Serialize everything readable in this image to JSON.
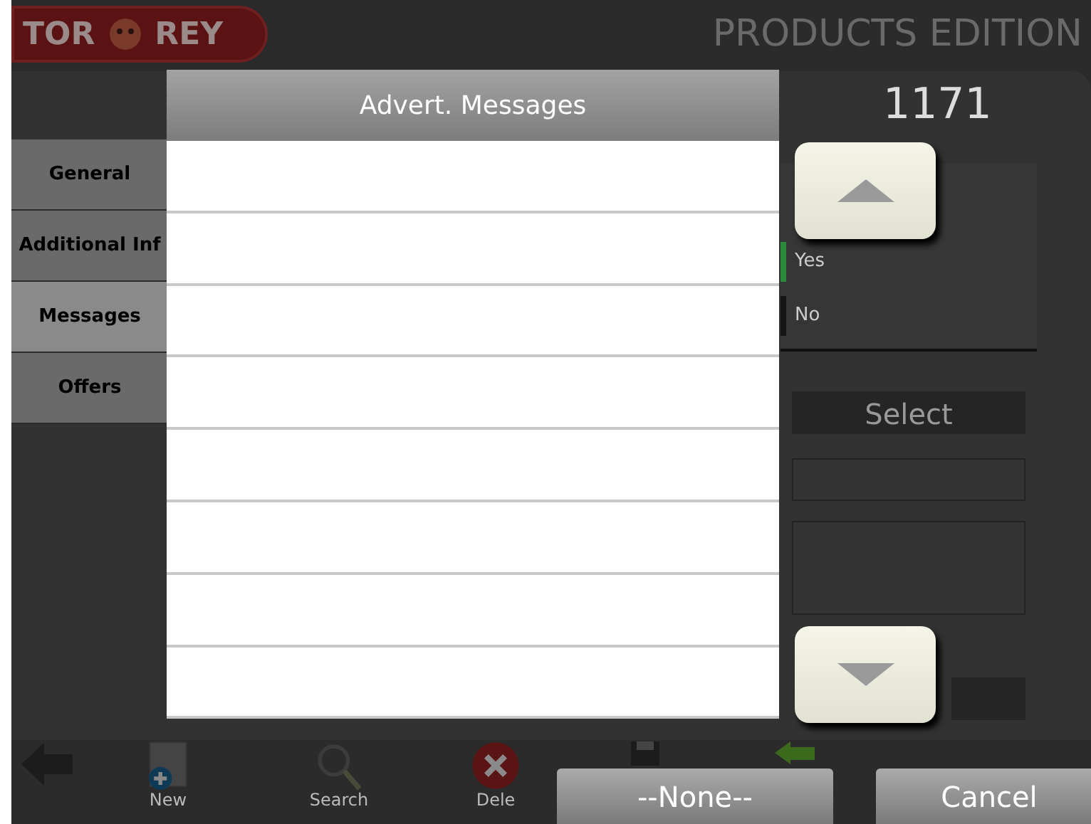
{
  "header": {
    "logo_text": [
      "TOR",
      "REY"
    ],
    "title": "PRODUCTS EDITION"
  },
  "record_number": "1171",
  "tabs": [
    {
      "label": "General",
      "selected": false
    },
    {
      "label": "Additional Inf",
      "selected": false
    },
    {
      "label": "Messages",
      "selected": true
    },
    {
      "label": "Offers",
      "selected": false
    }
  ],
  "options": [
    {
      "label": "Yes",
      "selected": true
    },
    {
      "label": "No",
      "selected": false
    }
  ],
  "select_button": "Select",
  "toolbar": [
    {
      "kind": "back"
    },
    {
      "kind": "new",
      "label": "New"
    },
    {
      "kind": "search",
      "label": "Search"
    },
    {
      "kind": "delete",
      "label": "Dele"
    },
    {
      "kind": "save"
    },
    {
      "kind": "exit"
    }
  ],
  "dialog": {
    "title": "Advert. Messages",
    "rows": [
      {
        "selected": false
      },
      {
        "selected": false
      },
      {
        "selected": false
      },
      {
        "selected": false
      },
      {
        "selected": false
      },
      {
        "selected": false
      },
      {
        "selected": false
      },
      {
        "selected": false
      }
    ],
    "buttons": [
      {
        "label": "--None--"
      },
      {
        "label": "Cancel"
      }
    ]
  }
}
